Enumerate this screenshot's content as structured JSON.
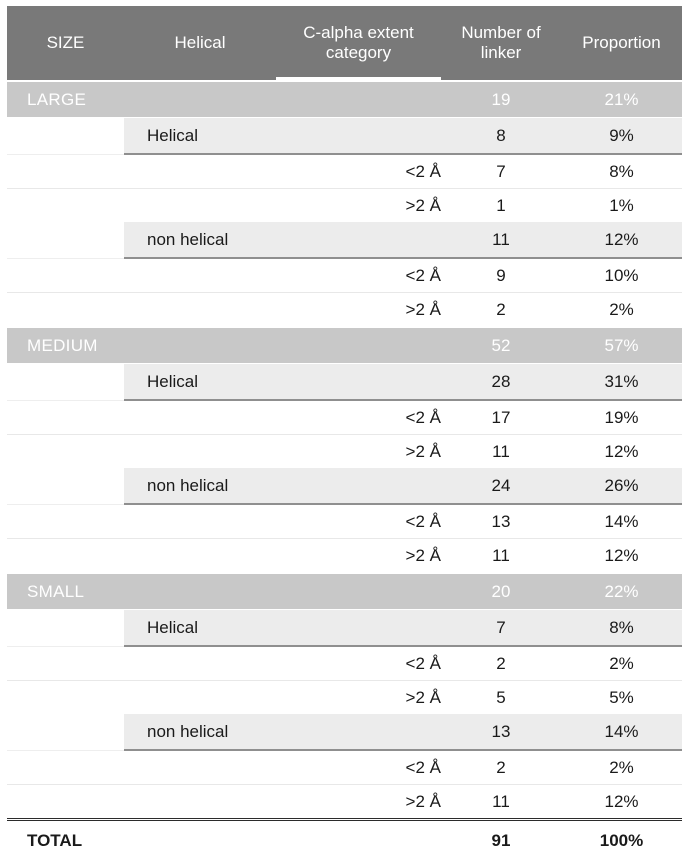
{
  "table": {
    "columns": [
      {
        "key": "size",
        "label": "SIZE"
      },
      {
        "key": "helical",
        "label": "Helical"
      },
      {
        "key": "extent",
        "label": "C-alpha extent category"
      },
      {
        "key": "number",
        "label": "Number of linker"
      },
      {
        "key": "prop",
        "label": "Proportion"
      }
    ],
    "header": {
      "size": "SIZE",
      "helical": "Helical",
      "extent": "C-alpha extent category",
      "number": "Number of linker",
      "proportion": "Proportion"
    },
    "rows": [
      {
        "type": "section",
        "size": "LARGE",
        "helical": "",
        "extent": "",
        "number": "19",
        "proportion": "21%"
      },
      {
        "type": "group",
        "size": "",
        "helical": "Helical",
        "extent": "",
        "number": "8",
        "proportion": "9%"
      },
      {
        "type": "detail",
        "size": "",
        "helical": "",
        "extent": "<2 Å",
        "number": "7",
        "proportion": "8%"
      },
      {
        "type": "detail",
        "size": "",
        "helical": "",
        "extent": ">2 Å",
        "number": "1",
        "proportion": "1%"
      },
      {
        "type": "group",
        "size": "",
        "helical": "non helical",
        "extent": "",
        "number": "11",
        "proportion": "12%"
      },
      {
        "type": "detail",
        "size": "",
        "helical": "",
        "extent": "<2 Å",
        "number": "9",
        "proportion": "10%"
      },
      {
        "type": "detail",
        "size": "",
        "helical": "",
        "extent": ">2 Å",
        "number": "2",
        "proportion": "2%"
      },
      {
        "type": "section",
        "size": "MEDIUM",
        "helical": "",
        "extent": "",
        "number": "52",
        "proportion": "57%"
      },
      {
        "type": "group",
        "size": "",
        "helical": "Helical",
        "extent": "",
        "number": "28",
        "proportion": "31%"
      },
      {
        "type": "detail",
        "size": "",
        "helical": "",
        "extent": "<2 Å",
        "number": "17",
        "proportion": "19%"
      },
      {
        "type": "detail",
        "size": "",
        "helical": "",
        "extent": ">2 Å",
        "number": "11",
        "proportion": "12%"
      },
      {
        "type": "group",
        "size": "",
        "helical": "non helical",
        "extent": "",
        "number": "24",
        "proportion": "26%"
      },
      {
        "type": "detail",
        "size": "",
        "helical": "",
        "extent": "<2 Å",
        "number": "13",
        "proportion": "14%"
      },
      {
        "type": "detail",
        "size": "",
        "helical": "",
        "extent": ">2 Å",
        "number": "11",
        "proportion": "12%"
      },
      {
        "type": "section",
        "size": "SMALL",
        "helical": "",
        "extent": "",
        "number": "20",
        "proportion": "22%"
      },
      {
        "type": "group",
        "size": "",
        "helical": "Helical",
        "extent": "",
        "number": "7",
        "proportion": "8%"
      },
      {
        "type": "detail",
        "size": "",
        "helical": "",
        "extent": "<2 Å",
        "number": "2",
        "proportion": "2%"
      },
      {
        "type": "detail",
        "size": "",
        "helical": "",
        "extent": ">2 Å",
        "number": "5",
        "proportion": "5%"
      },
      {
        "type": "group",
        "size": "",
        "helical": "non helical",
        "extent": "",
        "number": "13",
        "proportion": "14%"
      },
      {
        "type": "detail",
        "size": "",
        "helical": "",
        "extent": "<2 Å",
        "number": "2",
        "proportion": "2%"
      },
      {
        "type": "detail",
        "size": "",
        "helical": "",
        "extent": ">2 Å",
        "number": "11",
        "proportion": "12%"
      },
      {
        "type": "total",
        "size": "TOTAL",
        "helical": "",
        "extent": "",
        "number": "91",
        "proportion": "100%"
      }
    ]
  },
  "colors": {
    "header_background": "#797979",
    "header_text": "#ffffff",
    "section_band": "#c8c8c8",
    "section_text": "#ffffff",
    "group_band": "#ececec",
    "group_underline": "#8f8f8f",
    "row_separator": "#e8e8e8",
    "body_text": "#1a1a1a",
    "page_background": "#ffffff"
  }
}
